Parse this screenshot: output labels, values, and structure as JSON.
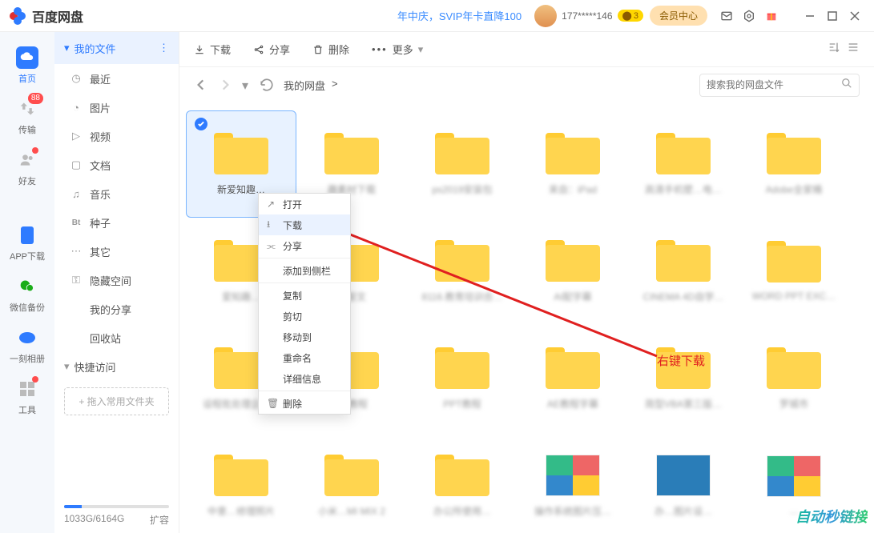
{
  "titlebar": {
    "app_name": "百度网盘",
    "promo": "年中庆，SVIP年卡直降100",
    "username": "177*****146",
    "coin_value": "3",
    "member_btn": "会员中心"
  },
  "rail": {
    "home": "首页",
    "transfer": "传输",
    "transfer_badge": "88",
    "friends": "好友",
    "app_download": "APP下载",
    "wechat_backup": "微信备份",
    "album": "一刻相册",
    "tools": "工具"
  },
  "sidebar": {
    "my_files": "我的文件",
    "recent": "最近",
    "images": "图片",
    "video": "视频",
    "docs": "文档",
    "music": "音乐",
    "bt_prefix": "Bt",
    "seeds": "种子",
    "other": "其它",
    "hidden": "隐藏空间",
    "my_share": "我的分享",
    "recycle": "回收站",
    "quick_access": "快捷访问",
    "quick_placeholder": "+ 拖入常用文件夹",
    "storage_used": "1033G/6164G",
    "expand": "扩容"
  },
  "toolbar": {
    "download": "下载",
    "share": "分享",
    "delete": "删除",
    "more": "更多"
  },
  "navbar": {
    "breadcrumb_root": "我的网盘",
    "search_placeholder": "搜索我的网盘文件"
  },
  "context_menu": {
    "open": "打开",
    "download": "下载",
    "share": "分享",
    "add_sidebar": "添加到侧栏",
    "copy": "复制",
    "cut": "剪切",
    "move_to": "移动到",
    "rename": "重命名",
    "details": "详细信息",
    "delete": "删除"
  },
  "folders": {
    "r1": [
      "新爱知趣…",
      "趣素材下载",
      "ps2019安装包",
      "来自：iPad",
      "高清手机壁…电…",
      "Adobe全家桶"
    ],
    "r2": [
      "爱知趣…",
      "罗智文",
      "8116.教育培训合…",
      "AI配字幕",
      "CINEMA 4D自学…",
      "WORD PPT EXC…"
    ],
    "r3": [
      "设程批处理企业…",
      "PS教程",
      "PPT教程",
      "AE教程字幕",
      "简型VBA第三版…",
      "罗城市"
    ],
    "r4": [
      "中意…修理照片",
      "小米…MI MIX 2",
      "办公所使用…",
      "操作系统图片压…",
      "办…图片设…",
      "…"
    ]
  },
  "annotation": {
    "text": "右键下载",
    "watermark": "自动秒链接"
  }
}
